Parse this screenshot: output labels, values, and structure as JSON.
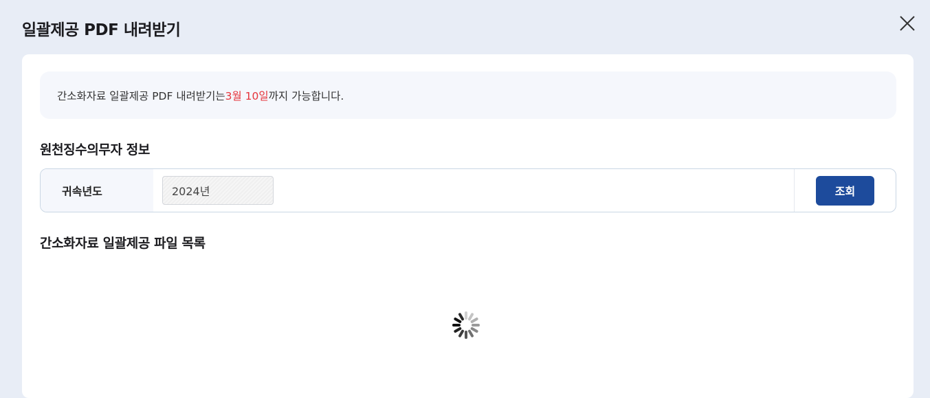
{
  "modal": {
    "title": "일괄제공 PDF 내려받기",
    "close_icon": "close-icon"
  },
  "notice": {
    "prefix": "간소화자료 일괄제공 PDF 내려받기는 ",
    "highlight": "3월 10일",
    "suffix": "까지 가능합니다.",
    "highlight_color": "#e5343b"
  },
  "withholding": {
    "section_title": "원천징수의무자 정보",
    "year_label": "귀속년도",
    "year_value": "2024년",
    "search_label": "조회",
    "button_color": "#1d4b9c"
  },
  "files": {
    "section_title": "간소화자료 일괄제공 파일 목록",
    "loading_icon": "loading-spinner-icon"
  }
}
